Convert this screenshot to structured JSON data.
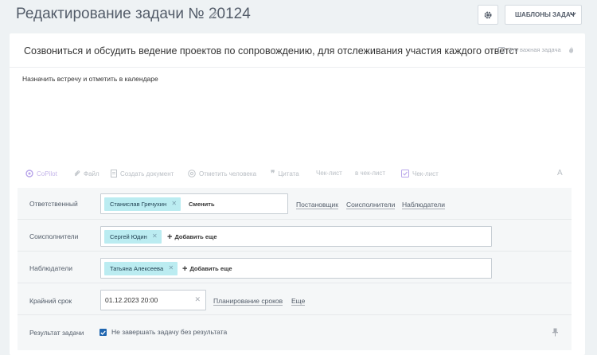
{
  "header": {
    "title": "Редактирование задачи № 20124",
    "templates_label": "ШАБЛОНЫ ЗАДАЧ"
  },
  "task": {
    "title": "Созвониться и обсудить ведение проектов по сопровождению, для отслеживания участия каждого ответст",
    "important_label": "Это важная задача",
    "important_checked": false,
    "description": "Назначить встречу и отметить в календаре"
  },
  "toolbar": {
    "copilot": "CoPilot",
    "file": "Файл",
    "create_doc": "Создать документ",
    "mention": "Отметить человека",
    "quote": "Цитата",
    "checklist_1": "Чек-лист",
    "checklist_2": "в чек-лист",
    "checklist_3": "Чек-лист",
    "font": "A"
  },
  "fields": {
    "responsible": {
      "label": "Ответственный",
      "person": "Станислав Гречухин",
      "change": "Сменить",
      "links": [
        "Постановщик",
        "Соисполнители",
        "Наблюдатели"
      ]
    },
    "coexecutors": {
      "label": "Соисполнители",
      "person": "Сергей Юдин",
      "add": "Добавить еще"
    },
    "observers": {
      "label": "Наблюдатели",
      "person": "Татьяна Алексеева",
      "add": "Добавить еще"
    },
    "deadline": {
      "label": "Крайний срок",
      "value": "01.12.2023 20:00",
      "planning": "Планирование сроков",
      "more": "Еще"
    },
    "result": {
      "label": "Результат задачи",
      "checkbox_label": "Не завершать задачу без результата",
      "checked": true
    }
  },
  "colors": {
    "accent_blue": "#2066b0",
    "chip_bg": "#bbecf1",
    "copilot_purple": "#c5b6ea"
  }
}
